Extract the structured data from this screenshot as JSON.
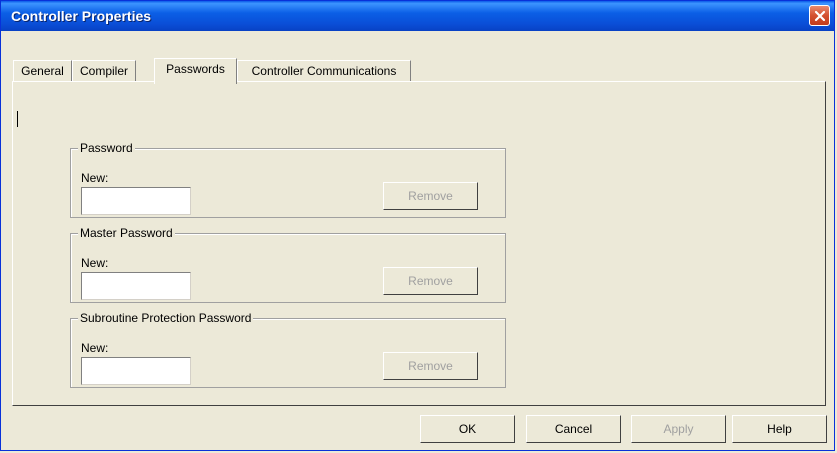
{
  "window": {
    "title": "Controller Properties"
  },
  "tabs": [
    {
      "label": "General"
    },
    {
      "label": "Compiler"
    },
    {
      "label": "Passwords"
    },
    {
      "label": "Controller Communications"
    }
  ],
  "groups": [
    {
      "title": "Password",
      "new_label": "New:",
      "value": "",
      "remove_label": "Remove"
    },
    {
      "title": "Master Password",
      "new_label": "New:",
      "value": "",
      "remove_label": "Remove"
    },
    {
      "title": "Subroutine Protection Password",
      "new_label": "New:",
      "value": "",
      "remove_label": "Remove"
    }
  ],
  "buttons": {
    "ok": "OK",
    "cancel": "Cancel",
    "apply": "Apply",
    "help": "Help"
  },
  "colors": {
    "title_bar": "#0a5ae8",
    "face": "#ece9d8",
    "close": "#d4502f"
  }
}
